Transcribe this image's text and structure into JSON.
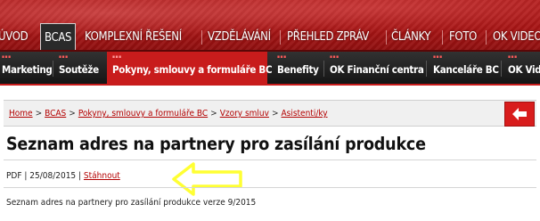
{
  "main_nav": {
    "items": [
      {
        "label": "ÚVOD"
      },
      {
        "label": "BCAS",
        "active": true
      },
      {
        "label": "KOMPLEXNÍ ŘEŠENÍ"
      },
      {
        "label": "VZDĚLÁVÁNÍ"
      },
      {
        "label": "PŘEHLED ZPRÁV"
      },
      {
        "label": "ČLÁNKY"
      },
      {
        "label": "FOTO"
      },
      {
        "label": "OK VIDEO"
      }
    ]
  },
  "sub_nav": {
    "items": [
      {
        "label": "Marketing"
      },
      {
        "label": "Soutěže"
      },
      {
        "label": "Pokyny, smlouvy a formuláře BC",
        "active": true
      },
      {
        "label": "Benefity"
      },
      {
        "label": "OK Finanční centra"
      },
      {
        "label": "Kanceláře BC"
      },
      {
        "label": "OK Video"
      }
    ]
  },
  "breadcrumb": {
    "items": [
      "Home",
      "BCAS",
      "Pokyny, smlouvy a formuláře BC",
      "Vzory smluv",
      "Asistenti/ky"
    ],
    "separator": ">"
  },
  "back_button": {
    "icon": "arrow-left-icon",
    "color": "#d81c1c"
  },
  "page": {
    "title": "Seznam adres na partnery pro zasílání produkce",
    "file_type": "PDF",
    "date": "25/08/2015",
    "separator": "|",
    "download_label": "Stáhnout",
    "description": "Seznam adres na partnery pro zasílání produkce verze 9/2015"
  },
  "annotation": {
    "icon": "left-arrow-annotation-icon",
    "color": "#ffff33"
  },
  "colors": {
    "accent": "#c81c1c",
    "link": "#b30000",
    "dark_bar": "#1f1f1f"
  }
}
